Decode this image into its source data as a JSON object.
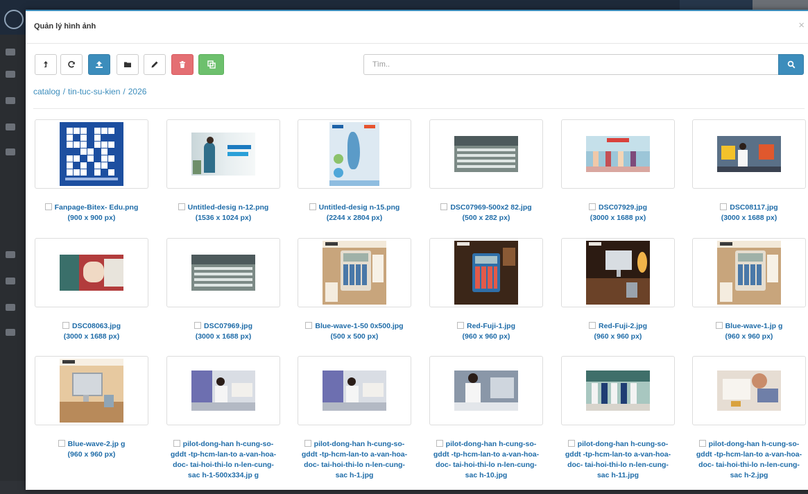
{
  "modal": {
    "title": "Quản lý hình ảnh",
    "close_glyph": "×"
  },
  "toolbar": {
    "buttons": [
      {
        "name": "parent-folder-button",
        "icon": "level-up-icon"
      },
      {
        "name": "refresh-button",
        "icon": "refresh-icon"
      },
      {
        "name": "upload-button",
        "icon": "upload-icon"
      },
      {
        "name": "new-folder-button",
        "icon": "folder-icon"
      },
      {
        "name": "rename-button",
        "icon": "pencil-icon"
      },
      {
        "name": "delete-button",
        "icon": "trash-icon"
      },
      {
        "name": "copy-button",
        "icon": "copy-icon"
      }
    ]
  },
  "search": {
    "placeholder": "Tìm..",
    "button_icon": "search-icon"
  },
  "breadcrumb": [
    "catalog",
    "tin-tuc-su-kien",
    "2026"
  ],
  "colors": {
    "primary": "#3c8dbc",
    "danger": "#e46f73",
    "success": "#6dc06d",
    "link": "#1f6ca8"
  },
  "images": [
    {
      "name": "Fanpage-Bitex- Edu.png",
      "size": "(900 x 900 px)",
      "kind": "qr"
    },
    {
      "name": "Untitled-desig n-12.png",
      "size": "(1536 x 1024 px)",
      "kind": "banner"
    },
    {
      "name": "Untitled-desig n-15.png",
      "size": "(2244 x 2804 px)",
      "kind": "poster"
    },
    {
      "name": "DSC07969-500x2 82.jpg",
      "size": "(500 x 282 px)",
      "kind": "hall"
    },
    {
      "name": "DSC07929.jpg",
      "size": "(3000 x 1688 px)",
      "kind": "stage"
    },
    {
      "name": "DSC08117.jpg",
      "size": "(3000 x 1688 px)",
      "kind": "kids"
    },
    {
      "name": "DSC08063.jpg",
      "size": "(3000 x 1688 px)",
      "kind": "class"
    },
    {
      "name": "DSC07969.jpg",
      "size": "(3000 x 1688 px)",
      "kind": "hall"
    },
    {
      "name": "Blue-wave-1-50 0x500.jpg",
      "size": "(500 x 500 px)",
      "kind": "calc-beige"
    },
    {
      "name": "Red-Fuji-1.jpg",
      "size": "(960 x 960 px)",
      "kind": "calc-dark"
    },
    {
      "name": "Red-Fuji-2.jpg",
      "size": "(960 x 960 px)",
      "kind": "calc-desk"
    },
    {
      "name": "Blue-wave-1.jp g",
      "size": "(960 x 960 px)",
      "kind": "calc-beige"
    },
    {
      "name": "Blue-wave-2.jp g",
      "size": "(960 x 960 px)",
      "kind": "calc-imac"
    },
    {
      "name": "pilot-dong-han h-cung-so-gddt -tp-hcm-lan-to a-van-hoa-doc- tai-hoi-thi-lo n-len-cung-sac h-1-500x334.jp g",
      "size": "",
      "kind": "students"
    },
    {
      "name": "pilot-dong-han h-cung-so-gddt -tp-hcm-lan-to a-van-hoa-doc- tai-hoi-thi-lo n-len-cung-sac h-1.jpg",
      "size": "",
      "kind": "students"
    },
    {
      "name": "pilot-dong-han h-cung-so-gddt -tp-hcm-lan-to a-van-hoa-doc- tai-hoi-thi-lo n-len-cung-sac h-10.jpg",
      "size": "",
      "kind": "students2"
    },
    {
      "name": "pilot-dong-han h-cung-so-gddt -tp-hcm-lan-to a-van-hoa-doc- tai-hoi-thi-lo n-len-cung-sac h-11.jpg",
      "size": "",
      "kind": "group"
    },
    {
      "name": "pilot-dong-han h-cung-so-gddt -tp-hcm-lan-to a-van-hoa-doc- tai-hoi-thi-lo n-len-cung-sac h-2.jpg",
      "size": "",
      "kind": "writing"
    }
  ]
}
